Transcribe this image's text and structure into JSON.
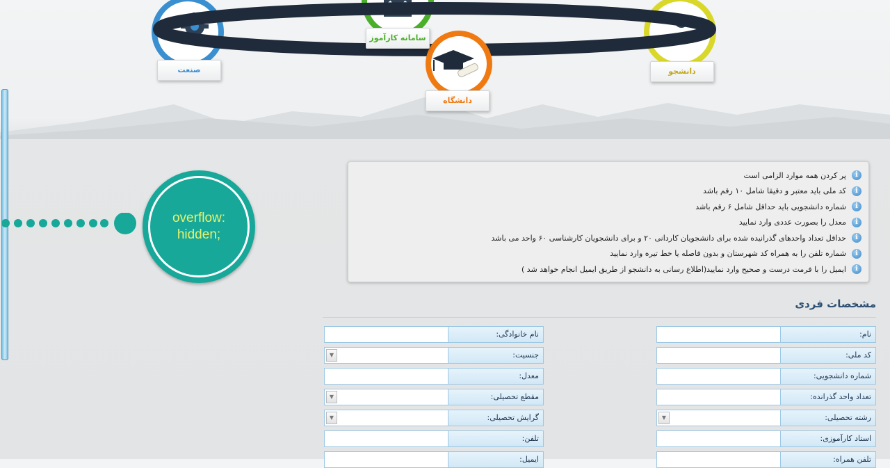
{
  "nav": {
    "items": [
      {
        "label": "صنعت",
        "color": "#3a8fd0"
      },
      {
        "label": "سامانه کارآموز",
        "color": "#4caf2a"
      },
      {
        "label": "دانشگاه",
        "color": "#f07a12"
      },
      {
        "label": "دانشجو",
        "color": "#c9c820"
      }
    ],
    "ring_color": "#1f2b3a"
  },
  "overflow_badge": {
    "line1": "overflow:",
    "line2": "hidden;"
  },
  "info": {
    "icon": "i",
    "items": [
      "پر کردن همه موارد الزامی است",
      "کد ملی باید معتبر و دقیقا شامل ۱۰ رقم باشد",
      "شماره دانشجویی باید حداقل شامل ۶ رقم باشد",
      "معدل را بصورت عددی وارد نمایید",
      "حداقل تعداد واحدهای گذرانیده شده برای دانشجویان کاردانی ۲۰ و برای دانشجویان کارشناسی ۶۰ واحد می باشد",
      "شماره تلفن را به همراه کد شهرستان و بدون فاصله یا خط تیره وارد نمایید",
      "ایمیل را با فرمت درست و صحیح وارد نمایید(اطلاع رسانی به دانشجو از طریق ایمیل انجام خواهد شد )"
    ]
  },
  "section": {
    "title": "مشخصات فردی"
  },
  "form": {
    "right": [
      {
        "label": "نام:",
        "type": "text",
        "value": ""
      },
      {
        "label": "کد ملی:",
        "type": "text",
        "value": ""
      },
      {
        "label": "شماره دانشجویی:",
        "type": "text",
        "value": ""
      },
      {
        "label": "تعداد واحد گذرانده:",
        "type": "text",
        "value": ""
      },
      {
        "label": "رشته تحصیلی:",
        "type": "select",
        "value": ""
      },
      {
        "label": "استاد کارآموزی:",
        "type": "text",
        "value": ""
      },
      {
        "label": "تلفن همراه:",
        "type": "text",
        "value": ""
      }
    ],
    "left": [
      {
        "label": "نام خانوادگی:",
        "type": "text",
        "value": ""
      },
      {
        "label": "جنسیت:",
        "type": "select",
        "value": ""
      },
      {
        "label": "معدل:",
        "type": "text",
        "value": ""
      },
      {
        "label": "مقطع تحصیلی:",
        "type": "select",
        "value": ""
      },
      {
        "label": "گرایش تحصیلی:",
        "type": "select",
        "value": ""
      },
      {
        "label": "تلفن:",
        "type": "text",
        "value": ""
      },
      {
        "label": "ایمیل:",
        "type": "text",
        "value": ""
      }
    ]
  }
}
